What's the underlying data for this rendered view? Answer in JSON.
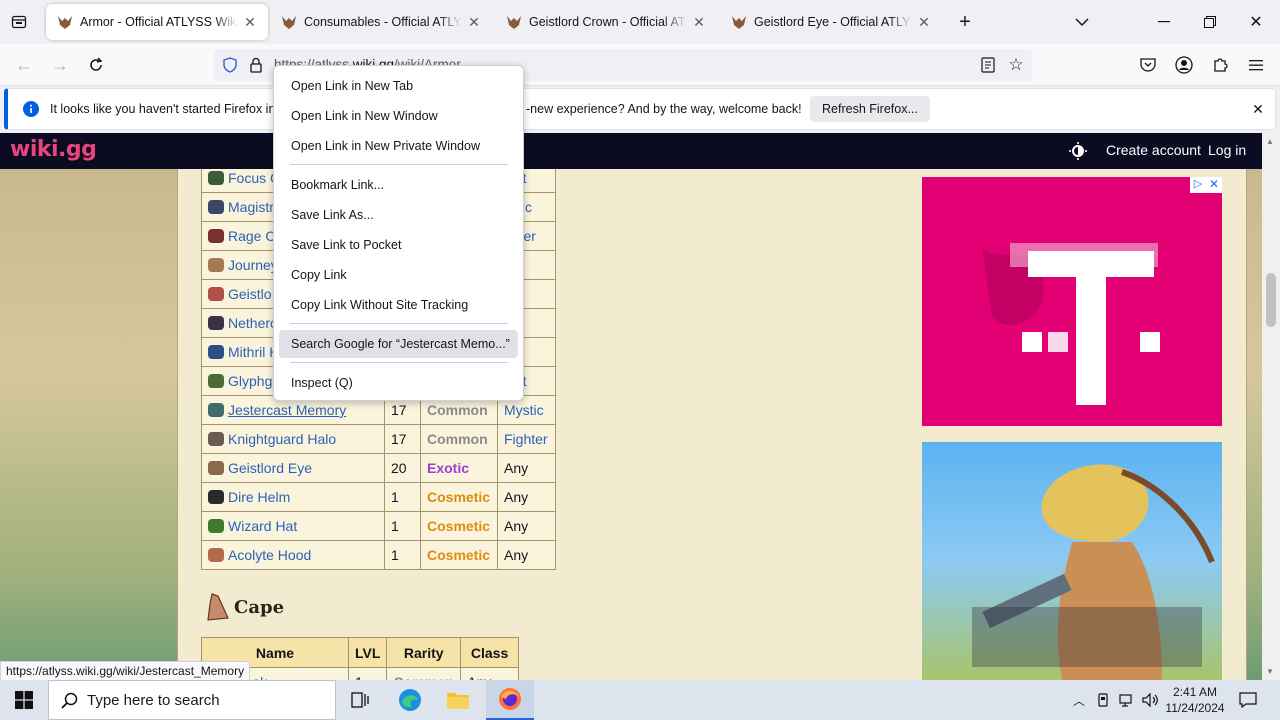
{
  "browser": {
    "tabs": [
      {
        "title": "Armor - Official ATLYSS Wiki",
        "active": true
      },
      {
        "title": "Consumables - Official ATLYSS Wiki",
        "active": false
      },
      {
        "title": "Geistlord Crown - Official ATLYSS Wiki",
        "active": false
      },
      {
        "title": "Geistlord Eye - Official ATLYSS Wiki",
        "active": false
      }
    ],
    "url_prefix": "https://atlyss.",
    "url_domain": "wiki.gg",
    "url_path": "/wiki/Armor",
    "notification": {
      "message": "It looks like you haven't started Firefox in a w",
      "message_end": "-new experience? And by the way, welcome back!",
      "button": "Refresh Firefox..."
    },
    "status_url": "https://atlyss.wiki.gg/wiki/Jestercast_Memory"
  },
  "wiki": {
    "logo": "wiki.gg",
    "create_account": "Create account",
    "log_in": "Log in",
    "rows": [
      {
        "name": "Focus C",
        "lvl": "",
        "rarity": "",
        "rarity_class": "",
        "cls": "ndit",
        "icon_color": "#3d5a3a"
      },
      {
        "name": "Magistr",
        "lvl": "",
        "rarity": "",
        "rarity_class": "",
        "cls": "ystic",
        "icon_color": "#3b4766"
      },
      {
        "name": "Rage C",
        "lvl": "",
        "rarity": "",
        "rarity_class": "",
        "cls": "ghter",
        "icon_color": "#7a2f2f"
      },
      {
        "name": "Journey",
        "lvl": "",
        "rarity": "",
        "rarity_class": "",
        "cls": "y",
        "icon_color": "#a37a52"
      },
      {
        "name": "Geistlo",
        "lvl": "",
        "rarity": "",
        "rarity_class": "",
        "cls": "y",
        "icon_color": "#b0504a"
      },
      {
        "name": "Netherc",
        "lvl": "",
        "rarity": "",
        "rarity_class": "",
        "cls": "y",
        "icon_color": "#3a3346"
      },
      {
        "name": "Mithril H",
        "lvl": "",
        "rarity": "",
        "rarity_class": "",
        "cls": "y",
        "icon_color": "#2d4f86"
      },
      {
        "name": "Glyphg",
        "lvl": "",
        "rarity": "",
        "rarity_class": "",
        "cls": "ndit",
        "icon_color": "#4c6a32"
      },
      {
        "name": "Jestercast Memory",
        "lvl": "17",
        "rarity": "Common",
        "rarity_class": "r-common",
        "cls": "Mystic",
        "icon_color": "#3f6b6b",
        "underline": true
      },
      {
        "name": "Knightguard Halo",
        "lvl": "17",
        "rarity": "Common",
        "rarity_class": "r-common",
        "cls": "Fighter",
        "icon_color": "#6b5b52"
      },
      {
        "name": "Geistlord Eye",
        "lvl": "20",
        "rarity": "Exotic",
        "rarity_class": "r-exotic",
        "cls": "Any",
        "icon_color": "#8a6a4a"
      },
      {
        "name": "Dire Helm",
        "lvl": "1",
        "rarity": "Cosmetic",
        "rarity_class": "r-cosmetic",
        "cls": "Any",
        "icon_color": "#2a2a2a"
      },
      {
        "name": "Wizard Hat",
        "lvl": "1",
        "rarity": "Cosmetic",
        "rarity_class": "r-cosmetic",
        "cls": "Any",
        "icon_color": "#3f7a2e"
      },
      {
        "name": "Acolyte Hood",
        "lvl": "1",
        "rarity": "Cosmetic",
        "rarity_class": "r-cosmetic",
        "cls": "Any",
        "icon_color": "#b56b4a"
      }
    ],
    "cape_heading": "Cape",
    "cape_headers": [
      "Name",
      "LVL",
      "Rarity",
      "Class"
    ],
    "cape_partial": {
      "name": "nte Cloak",
      "lvl": "1",
      "rarity": "Common",
      "cls": "Any"
    }
  },
  "context_menu": {
    "items": [
      "Open Link in New Tab",
      "Open Link in New Window",
      "Open Link in New Private Window",
      "Bookmark Link...",
      "Save Link As...",
      "Save Link to Pocket",
      "Copy Link",
      "Copy Link Without Site Tracking",
      "Search Google for “Jestercast Memo...”",
      "Inspect (Q)"
    ]
  },
  "taskbar": {
    "search_placeholder": "Type here to search",
    "time": "2:41 AM",
    "date": "11/24/2024"
  },
  "colors": {
    "accent": "#0060df",
    "wiki_header": "#0b0b22",
    "logo": "#e8447d",
    "tmobile": "#e20074"
  }
}
